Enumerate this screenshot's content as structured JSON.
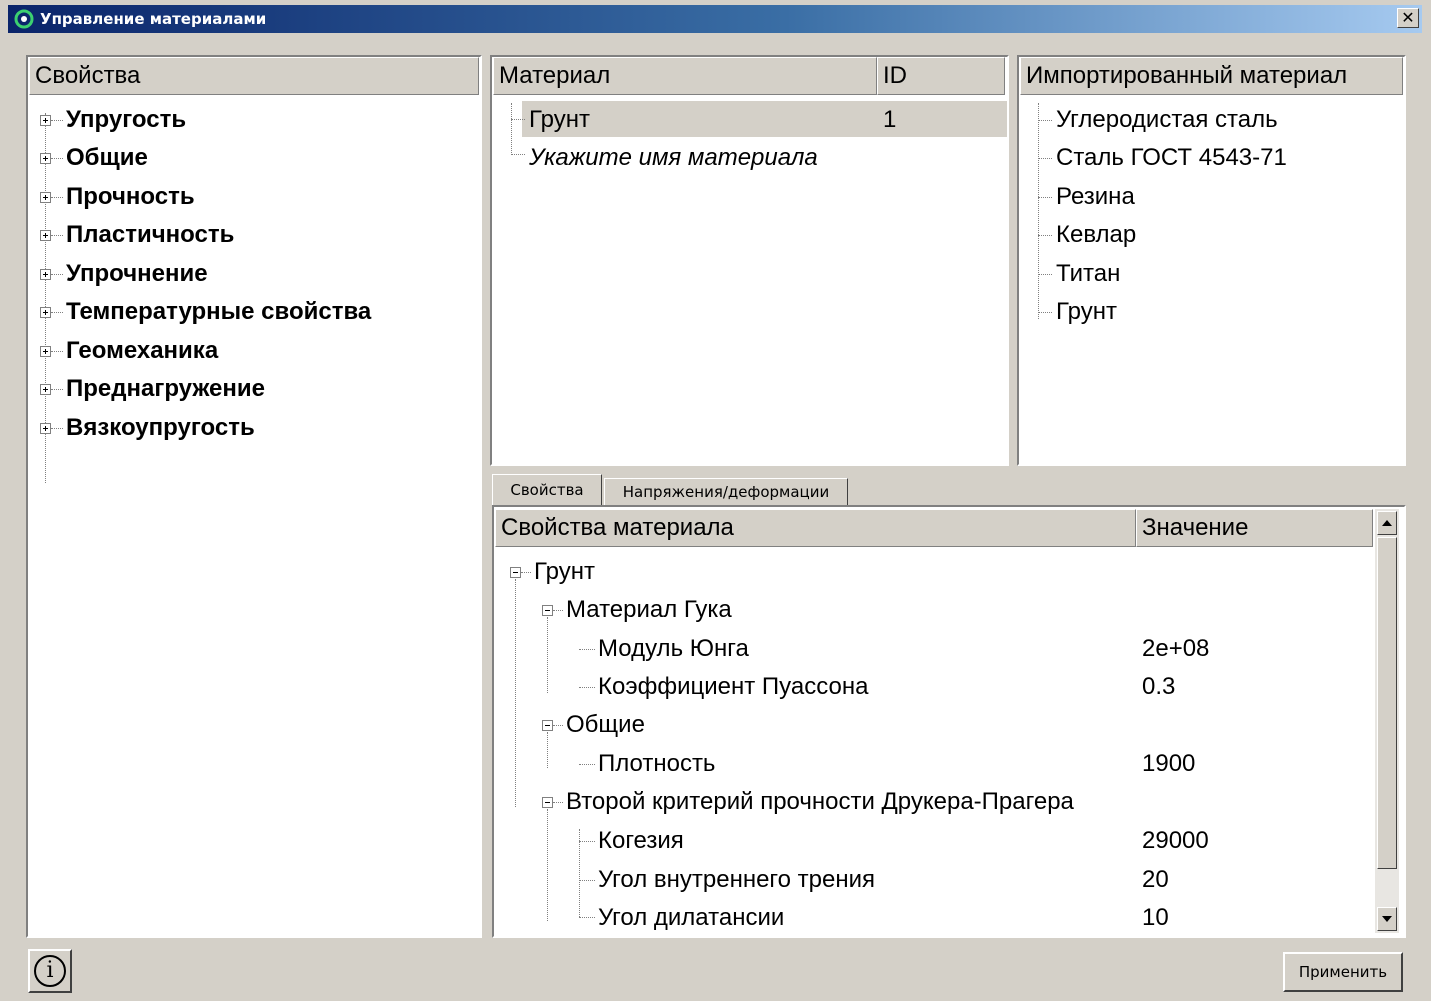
{
  "window": {
    "title": "Управление материалами",
    "close_symbol": "✕"
  },
  "properties_panel": {
    "header": "Свойства",
    "items": [
      "Упругость",
      "Общие",
      "Прочность",
      "Пластичность",
      "Упрочнение",
      "Температурные свойства",
      "Геомеханика",
      "Преднагружение",
      "Вязкоупругость"
    ]
  },
  "materials_panel": {
    "col_material": "Материал",
    "col_id": "ID",
    "rows": [
      {
        "name": "Грунт",
        "id": "1"
      }
    ],
    "new_placeholder": "Укажите имя материала"
  },
  "imported_panel": {
    "header": "Импортированный материал",
    "items": [
      "Углеродистая сталь",
      "Сталь ГОСТ 4543-71",
      "Резина",
      "Кевлар",
      "Титан",
      "Грунт"
    ]
  },
  "tabs": {
    "properties": "Свойства",
    "stress_strain": "Напряжения/деформации"
  },
  "material_props": {
    "col_property": "Свойства материала",
    "col_value": "Значение",
    "root": "Грунт",
    "hooke": "Материал Гука",
    "young_label": "Модуль Юнга",
    "young_value": "2e+08",
    "poisson_label": "Коэффициент Пуассона",
    "poisson_value": "0.3",
    "general": "Общие",
    "density_label": "Плотность",
    "density_value": "1900",
    "drucker": "Второй критерий прочности Друкера-Прагера",
    "cohesion_label": "Когезия",
    "cohesion_value": "29000",
    "friction_label": "Угол внутреннего трения",
    "friction_value": "20",
    "dilatancy_label": "Угол дилатансии",
    "dilatancy_value": "10"
  },
  "footer": {
    "info_symbol": "i",
    "apply_label": "Применить"
  },
  "icons": [
    "app-icon",
    "close-icon",
    "info-icon",
    "scroll-up-icon",
    "scroll-down-icon"
  ]
}
